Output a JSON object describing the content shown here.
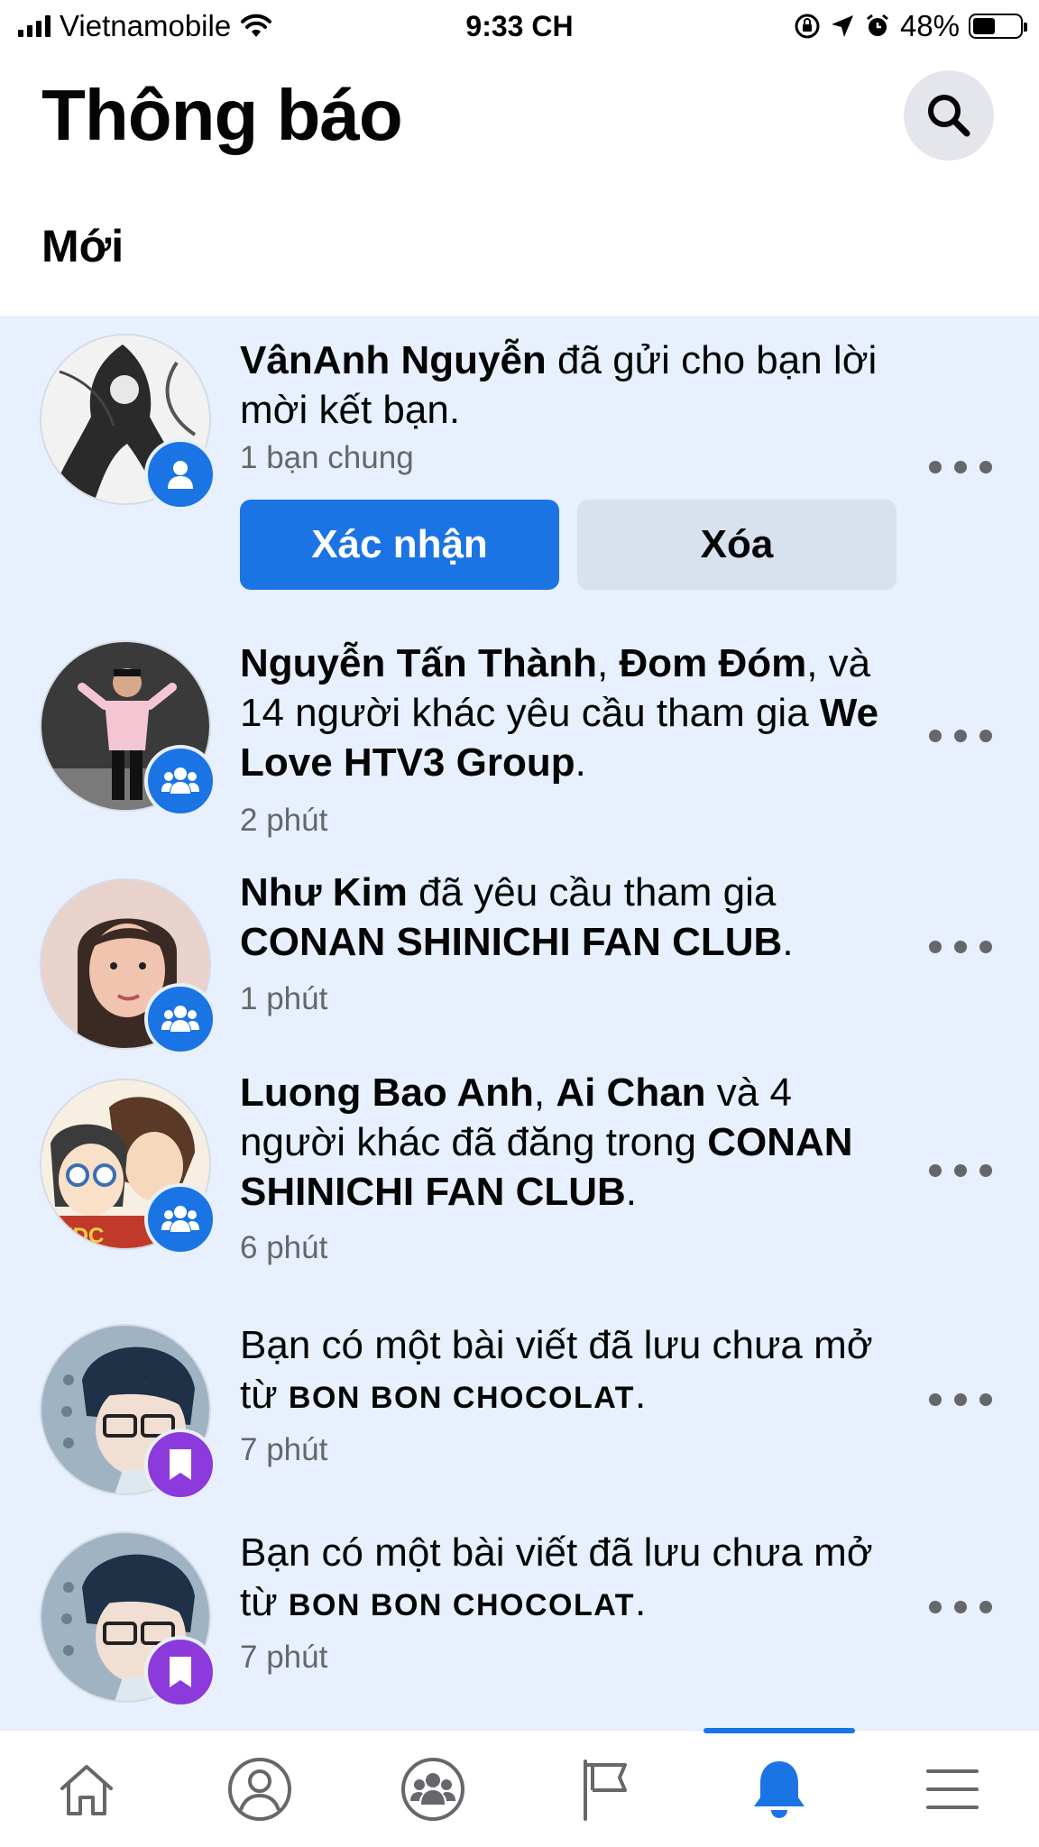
{
  "status_bar": {
    "carrier": "Vietnamobile",
    "time": "9:33 CH",
    "battery": "48%",
    "battery_level": 0.48
  },
  "header": {
    "title": "Thông báo"
  },
  "section": {
    "title": "Mới"
  },
  "notifications": [
    {
      "type": "friend_request",
      "name": "VânAnh Nguyễn",
      "text": " đã gửi cho bạn lời mời kết bạn.",
      "meta": "1 bạn chung",
      "confirm_label": "Xác nhận",
      "delete_label": "Xóa",
      "badge_icon": "person-icon",
      "badge_color": "#1b74e4"
    },
    {
      "type": "group_request",
      "name1": "Nguyễn Tấn Thành",
      "sep1": ", ",
      "name2": "Đom Đóm",
      "text": ", và 14 người khác yêu cầu tham gia ",
      "group": "We Love HTV3 Group",
      "end": ".",
      "time": "2 phút",
      "badge_icon": "group-icon",
      "badge_color": "#1b74e4"
    },
    {
      "type": "group_request",
      "name": "Như Kim",
      "text": " đã yêu cầu tham gia ",
      "group": "CONAN SHINICHI FAN CLUB",
      "end": ".",
      "time": "1 phút",
      "badge_icon": "group-icon",
      "badge_color": "#1b74e4"
    },
    {
      "type": "group_post",
      "name1": "Luong Bao Anh",
      "sep1": ", ",
      "name2": "Ai Chan",
      "text": " và 4 người khác đã đăng trong ",
      "group": "CONAN SHINICHI FAN CLUB",
      "end": ".",
      "time": "6 phút",
      "badge_icon": "group-icon",
      "badge_color": "#1b74e4"
    },
    {
      "type": "saved_post",
      "text": "Bạn có một bài viết đã lưu chưa mở từ ",
      "source": "BON BON CHOCOLAT",
      "end": ".",
      "time": "7 phút",
      "badge_icon": "bookmark-icon",
      "badge_color": "#8c3adb"
    },
    {
      "type": "saved_post",
      "text": "Bạn có một bài viết đã lưu chưa mở từ ",
      "source": "BON BON CHOCOLAT",
      "end": ".",
      "time": "7 phút",
      "badge_icon": "bookmark-icon",
      "badge_color": "#8c3adb"
    }
  ],
  "bottom_nav": [
    {
      "icon": "home-icon"
    },
    {
      "icon": "profile-icon"
    },
    {
      "icon": "groups-icon"
    },
    {
      "icon": "pages-flag-icon"
    },
    {
      "icon": "bell-icon",
      "active": true
    },
    {
      "icon": "menu-icon"
    }
  ],
  "colors": {
    "accent": "#1b74e4",
    "unread_bg": "#e7f0fc",
    "saved_badge": "#8c3adb",
    "muted_text": "#65676b"
  }
}
